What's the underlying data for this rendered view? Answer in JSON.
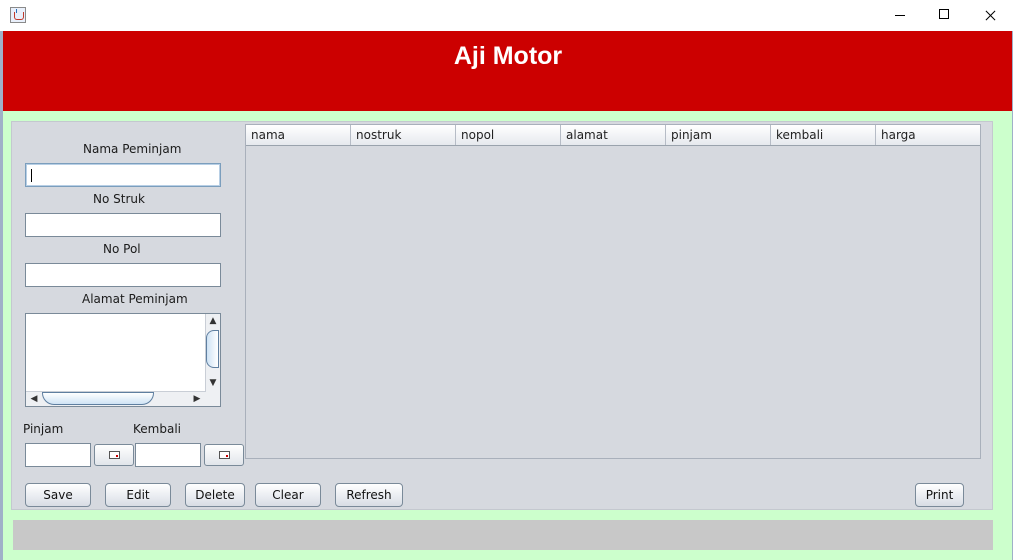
{
  "window": {
    "title": "",
    "controls": [
      "minimize",
      "maximize",
      "close"
    ],
    "icon": "java-cup-icon"
  },
  "header": {
    "title": "Aji Motor",
    "bg_color": "#cc0000",
    "text_color": "#ffffff"
  },
  "form": {
    "nama_label": "Nama Peminjam",
    "nama_value": "",
    "nostruk_label": "No Struk",
    "nostruk_value": "",
    "nopol_label": "No Pol",
    "nopol_value": "",
    "alamat_label": "Alamat Peminjam",
    "alamat_value": "",
    "pinjam_label": "Pinjam",
    "pinjam_value": "",
    "kembali_label": "Kembali",
    "kembali_value": ""
  },
  "table": {
    "columns": [
      "nama",
      "nostruk",
      "nopol",
      "alamat",
      "pinjam",
      "kembali",
      "harga"
    ],
    "rows": []
  },
  "buttons": {
    "save": "Save",
    "edit": "Edit",
    "delete": "Delete",
    "clear": "Clear",
    "refresh": "Refresh",
    "print": "Print"
  },
  "colors": {
    "accent": "#cc0000",
    "frame_bg": "#ccffcc",
    "panel_bg": "#d6d9df",
    "status_bg": "#c8c8c8"
  },
  "icons": {
    "calendar": "calendar-icon"
  }
}
